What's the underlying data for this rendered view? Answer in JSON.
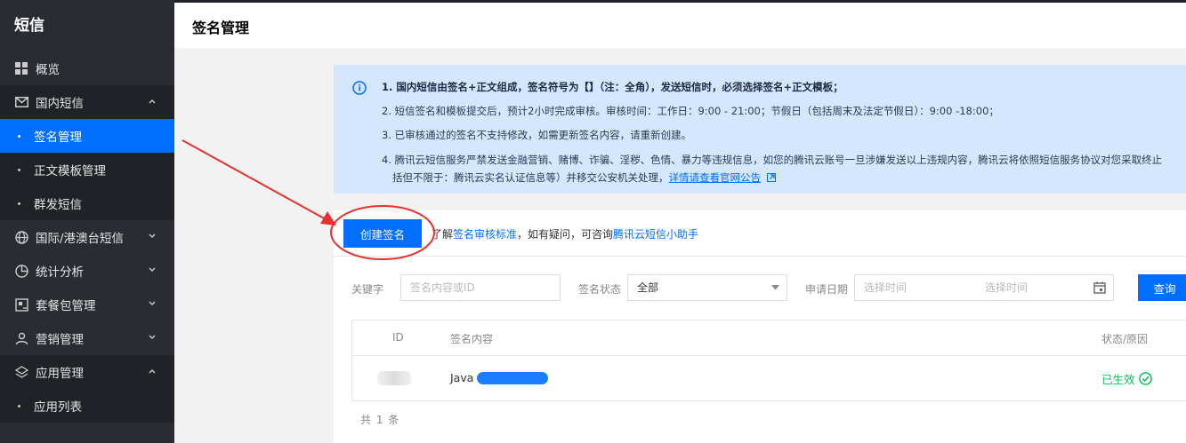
{
  "sidebar": {
    "brand": "短信",
    "items": [
      {
        "label": "概览"
      },
      {
        "label": "国内短信"
      },
      {
        "label": "国际/港澳台短信"
      },
      {
        "label": "统计分析"
      },
      {
        "label": "套餐包管理"
      },
      {
        "label": "营销管理"
      },
      {
        "label": "应用管理"
      }
    ],
    "sub_domestic": [
      {
        "label": "签名管理"
      },
      {
        "label": "正文模板管理"
      },
      {
        "label": "群发短信"
      }
    ],
    "sub_app": [
      {
        "label": "应用列表"
      }
    ]
  },
  "header": {
    "title": "签名管理"
  },
  "notice": {
    "line1": "1. 国内短信由签名+正文组成，签名符号为【】（注：全角），发送短信时，必须选择签名+正文模板；",
    "line2": "2. 短信签名和模板提交后，预计2小时完成审核。审核时间：工作日：9:00 - 21:00；节假日（包括周末及法定节假日）：9:00 -18:00；",
    "line3": "3. 已审核通过的签名不支持修改，如需更新签名内容，请重新创建。",
    "line4a": "4. 腾讯云短信服务严禁发送金融营销、赌博、诈骗、淫秽、色情、暴力等违规信息，如您的腾讯云账号一旦涉嫌发送以上违规内容，腾讯云将依照短信服务协议对您采取终止",
    "line4b": "括但不限于：腾讯云实名认证信息等）并移交公安机关处理，",
    "line4_link": "详情请查看官网公告"
  },
  "actions": {
    "create_label": "创建签名",
    "helper_prefix": "了解",
    "helper_link1": "签名审核标准",
    "helper_mid": "，如有疑问，可咨询",
    "helper_link2": "腾讯云短信小助手"
  },
  "filters": {
    "keyword_label": "关键字",
    "keyword_placeholder": "签名内容或ID",
    "status_label": "签名状态",
    "status_value": "全部",
    "date_label": "申请日期",
    "date_start_placeholder": "选择时间",
    "date_end_placeholder": "选择时间",
    "query_label": "查询"
  },
  "table": {
    "columns": [
      "ID",
      "签名内容",
      "状态/原因"
    ],
    "rows": [
      {
        "content": "Java",
        "status": "已生效"
      }
    ]
  },
  "footer": {
    "total": "共 1 条"
  },
  "colors": {
    "primary": "#006eff",
    "success": "#0abf5b",
    "sidebar": "#292d33",
    "annotation": "#e8302f"
  }
}
